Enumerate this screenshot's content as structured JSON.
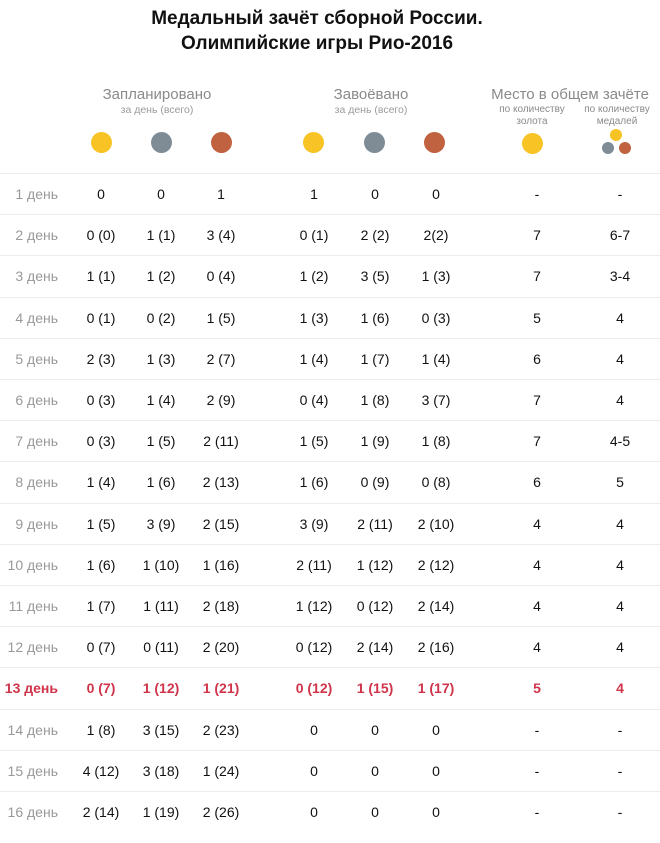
{
  "title_line1": "Медальный зачёт сборной России.",
  "title_line2": "Олимпийские игры Рио-2016",
  "groups": {
    "planned": {
      "label": "Запланировано",
      "sublabel": "за день (всего)"
    },
    "won": {
      "label": "Завоёвано",
      "sublabel": "за день (всего)"
    },
    "place": {
      "label": "Место в общем зачёте",
      "by_gold": "по количеству золота",
      "by_medals": "по количеству медалей"
    }
  },
  "colors": {
    "gold": "#f7c325",
    "silver": "#7f8c95",
    "bronze": "#c0623f",
    "highlight": "#d0344a"
  },
  "rows": [
    {
      "day": "1 день",
      "cells": [
        "0",
        "0",
        "1",
        "1",
        "0",
        "0",
        "-",
        "-"
      ]
    },
    {
      "day": "2 день",
      "cells": [
        "0 (0)",
        "1 (1)",
        "3 (4)",
        "0 (1)",
        "2 (2)",
        "2(2)",
        "7",
        "6-7"
      ]
    },
    {
      "day": "3 день",
      "cells": [
        "1 (1)",
        "1 (2)",
        "0 (4)",
        "1 (2)",
        "3 (5)",
        "1 (3)",
        "7",
        "3-4"
      ]
    },
    {
      "day": "4 день",
      "cells": [
        "0 (1)",
        "0 (2)",
        "1 (5)",
        "1 (3)",
        "1 (6)",
        "0 (3)",
        "5",
        "4"
      ]
    },
    {
      "day": "5 день",
      "cells": [
        "2 (3)",
        "1 (3)",
        "2 (7)",
        "1 (4)",
        "1 (7)",
        "1 (4)",
        "6",
        "4"
      ]
    },
    {
      "day": "6 день",
      "cells": [
        "0 (3)",
        "1 (4)",
        "2 (9)",
        "0 (4)",
        "1 (8)",
        "3 (7)",
        "7",
        "4"
      ]
    },
    {
      "day": "7 день",
      "cells": [
        "0 (3)",
        "1 (5)",
        "2 (11)",
        "1 (5)",
        "1 (9)",
        "1 (8)",
        "7",
        "4-5"
      ]
    },
    {
      "day": "8 день",
      "cells": [
        "1 (4)",
        "1 (6)",
        "2 (13)",
        "1 (6)",
        "0 (9)",
        "0 (8)",
        "6",
        "5"
      ]
    },
    {
      "day": "9 день",
      "cells": [
        "1 (5)",
        "3 (9)",
        "2 (15)",
        "3 (9)",
        "2 (11)",
        "2 (10)",
        "4",
        "4"
      ]
    },
    {
      "day": "10 день",
      "cells": [
        "1 (6)",
        "1 (10)",
        "1 (16)",
        "2 (11)",
        "1 (12)",
        "2 (12)",
        "4",
        "4"
      ]
    },
    {
      "day": "11 день",
      "cells": [
        "1 (7)",
        "1 (11)",
        "2 (18)",
        "1 (12)",
        "0 (12)",
        "2 (14)",
        "4",
        "4"
      ]
    },
    {
      "day": "12 день",
      "cells": [
        "0 (7)",
        "0 (11)",
        "2 (20)",
        "0 (12)",
        "2 (14)",
        "2 (16)",
        "4",
        "4"
      ]
    },
    {
      "day": "13 день",
      "cells": [
        "0 (7)",
        "1 (12)",
        "1 (21)",
        "0 (12)",
        "1 (15)",
        "1 (17)",
        "5",
        "4"
      ],
      "highlight": true
    },
    {
      "day": "14 день",
      "cells": [
        "1 (8)",
        "3 (15)",
        "2 (23)",
        "0",
        "0",
        "0",
        "-",
        "-"
      ]
    },
    {
      "day": "15 день",
      "cells": [
        "4 (12)",
        "3 (18)",
        "1 (24)",
        "0",
        "0",
        "0",
        "-",
        "-"
      ]
    },
    {
      "day": "16 день",
      "cells": [
        "2 (14)",
        "1 (19)",
        "2 (26)",
        "0",
        "0",
        "0",
        "-",
        "-"
      ]
    }
  ]
}
